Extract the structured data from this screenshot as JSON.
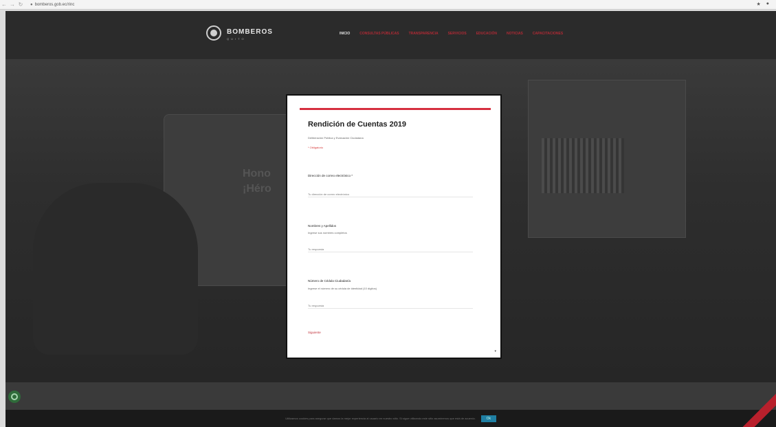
{
  "browser": {
    "url": "bomberos.gob.ec/rinc"
  },
  "site": {
    "logo_text": "BOMBEROS",
    "logo_sub": "QUITO",
    "nav": [
      "Inicio",
      "Consultas Públicas",
      "Transparencia",
      "Servicios",
      "Educación",
      "Noticias",
      "Capacitaciones"
    ],
    "hero_text": [
      "Hono",
      "¡Héro"
    ],
    "cookie_text": "Utilizamos cookies para asegurar que damos la mejor experiencia al usuario en nuestro sitio. Si sigue utilizando este sitio asumiremos que está de acuerdo.",
    "cookie_ok": "Ok"
  },
  "form": {
    "title": "Rendición de Cuentas 2019",
    "subtitle": "Deliberación Pública y Evaluación Ciudadana",
    "required_note": "* Obligatorio",
    "questions": [
      {
        "title": "Dirección de correo electrónico *",
        "desc": "",
        "placeholder": "Tu dirección de correo electrónico"
      },
      {
        "title": "Nombres y Apellidos",
        "desc": "Ingrese sus nombres completos",
        "placeholder": "Tu respuesta"
      },
      {
        "title": "Número de Cédula Ciudadanía",
        "desc": "Ingrese el número de su cédula de identidad (10 dígitos)",
        "placeholder": "Tu respuesta"
      }
    ],
    "next_label": "Siguiente"
  }
}
